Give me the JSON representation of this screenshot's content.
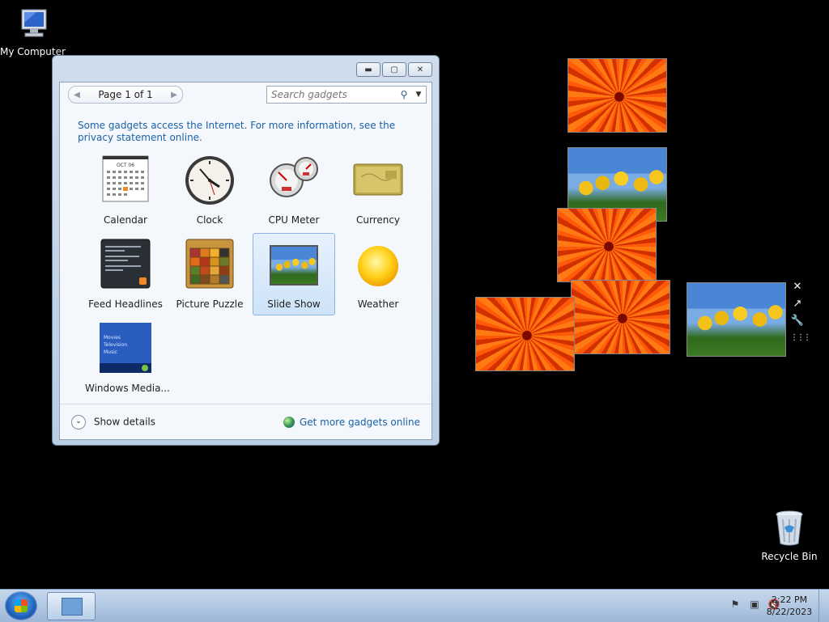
{
  "desktop": {
    "icons": [
      {
        "label": "My Computer"
      },
      {
        "label": "Recycle Bin"
      }
    ]
  },
  "window": {
    "pager": {
      "label": "Page 1 of 1"
    },
    "search": {
      "placeholder": "Search gadgets"
    },
    "info_text": "Some gadgets access the Internet.  For more information, see the privacy statement online.",
    "gadgets": [
      {
        "name": "Calendar",
        "icon": "calendar-icon"
      },
      {
        "name": "Clock",
        "icon": "clock-icon"
      },
      {
        "name": "CPU Meter",
        "icon": "cpu-meter-icon"
      },
      {
        "name": "Currency",
        "icon": "currency-icon"
      },
      {
        "name": "Feed Headlines",
        "icon": "feed-icon"
      },
      {
        "name": "Picture Puzzle",
        "icon": "puzzle-icon"
      },
      {
        "name": "Slide Show",
        "icon": "slideshow-icon",
        "selected": true
      },
      {
        "name": "Weather",
        "icon": "weather-icon"
      },
      {
        "name": "Windows Media...",
        "icon": "media-center-icon"
      }
    ],
    "calendar_month": "OCT 06",
    "media_menu": [
      "Movies",
      "Television",
      "Music"
    ],
    "show_details": "Show details",
    "get_more": "Get more gadgets online"
  },
  "taskbar": {
    "clock_time": "2:22 PM",
    "clock_date": "8/22/2023"
  },
  "colors": {
    "link": "#1b62a7",
    "selection": "#cde3f9"
  }
}
